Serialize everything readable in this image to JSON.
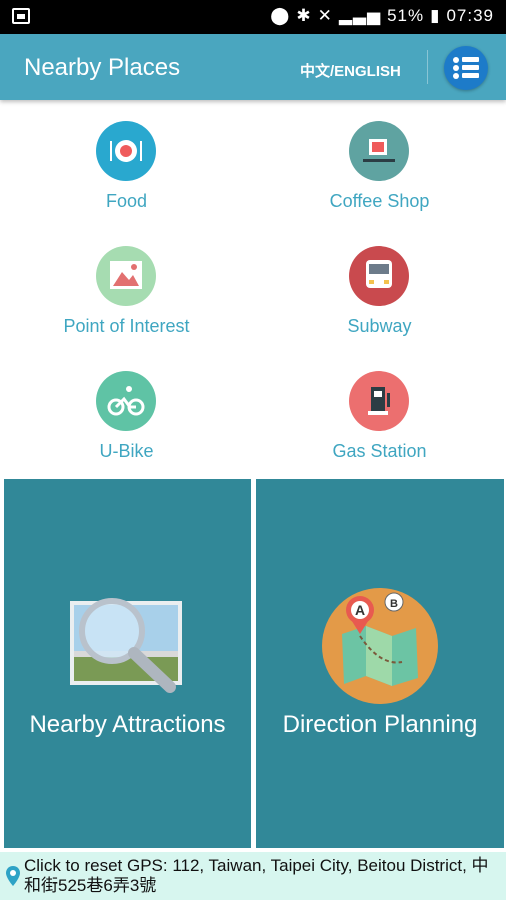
{
  "status_bar": {
    "battery": "51%",
    "time": "07:39"
  },
  "header": {
    "title": "Nearby Places",
    "language_toggle": "中文/ENGLISH"
  },
  "categories": [
    {
      "label": "Food",
      "icon": "food-icon",
      "color": "#29a8cf"
    },
    {
      "label": "Coffee Shop",
      "icon": "coffee-cup-icon",
      "color": "#5fa3a1"
    },
    {
      "label": "Point of Interest",
      "icon": "picture-landmark-icon",
      "color": "#a6dcb1"
    },
    {
      "label": "Subway",
      "icon": "train-icon",
      "color": "#c94a4e"
    },
    {
      "label": "U-Bike",
      "icon": "bicycle-icon",
      "color": "#5fc3a5"
    },
    {
      "label": "Gas Station",
      "icon": "fuel-pump-icon",
      "color": "#ec6f6f"
    }
  ],
  "tiles": [
    {
      "label": "Nearby Attractions",
      "icon": "magnifier-photo-icon"
    },
    {
      "label": "Direction Planning",
      "icon": "route-map-icon"
    }
  ],
  "footer": {
    "gps_text": "Click to reset GPS: 112, Taiwan, Taipei City, Beitou District, 中和街525巷6弄3號"
  },
  "colors": {
    "appbar": "#4aa6bf",
    "tile": "#318898",
    "label": "#3fa6c1",
    "footer": "#d7f6ef"
  }
}
